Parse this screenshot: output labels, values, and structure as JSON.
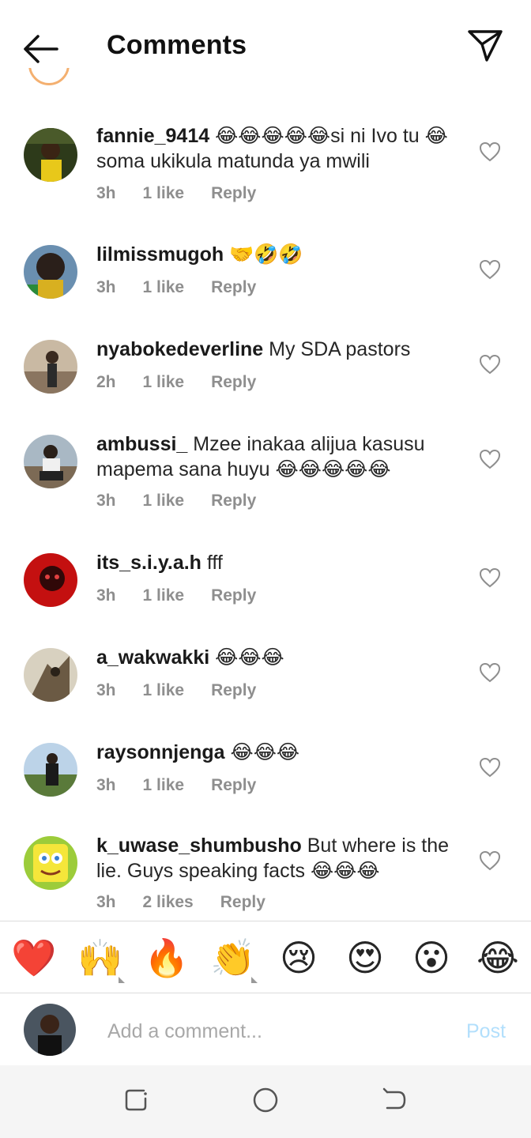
{
  "header": {
    "title": "Comments",
    "back_icon": "arrow-left-icon",
    "share_icon": "send-icon"
  },
  "comments": [
    {
      "username": "fannie_9414",
      "text": " 😂😂😂😂😂si ni Ivo tu 😂soma ukikula matunda ya mwili",
      "time": "3h",
      "likes": "1 like",
      "reply": "Reply"
    },
    {
      "username": "lilmissmugoh",
      "text": " 🤝🤣🤣",
      "time": "3h",
      "likes": "1 like",
      "reply": "Reply"
    },
    {
      "username": "nyabokedeverline",
      "text": " My SDA pastors",
      "time": "2h",
      "likes": "1 like",
      "reply": "Reply"
    },
    {
      "username": "ambussi_",
      "text": " Mzee inakaa alijua kasusu mapema sana huyu 😂😂😂😂😂",
      "time": "3h",
      "likes": "1 like",
      "reply": "Reply"
    },
    {
      "username": "its_s.i.y.a.h",
      "text": " fff",
      "time": "3h",
      "likes": "1 like",
      "reply": "Reply"
    },
    {
      "username": "a_wakwakki",
      "text": " 😂😂😂",
      "time": "3h",
      "likes": "1 like",
      "reply": "Reply"
    },
    {
      "username": "raysonnjenga",
      "text": " 😂😂😂",
      "time": "3h",
      "likes": "1 like",
      "reply": "Reply"
    },
    {
      "username": "k_uwase_shumbusho",
      "text": " But where is the lie. Guys speaking facts 😂😂😂",
      "time": "3h",
      "likes": "2 likes",
      "reply": "Reply"
    }
  ],
  "reactions": [
    "❤️",
    "🙌",
    "🔥",
    "👏",
    "😢",
    "😍",
    "😮",
    "😂"
  ],
  "composer": {
    "placeholder": "Add a comment...",
    "post_label": "Post"
  },
  "colors": {
    "post_disabled": "#b2dffc",
    "meta_text": "#8e8e8e",
    "heart_red": "#e0245e"
  }
}
